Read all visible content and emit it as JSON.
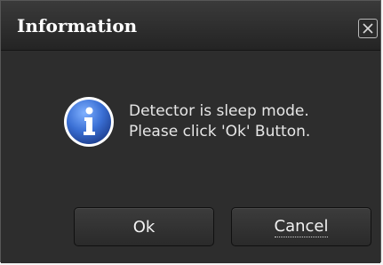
{
  "dialog": {
    "title": "Information",
    "close_icon": "close-icon",
    "icon": "info-icon",
    "message_lines": [
      "Detector is sleep mode.",
      "Please click 'Ok' Button."
    ],
    "buttons": {
      "ok_label": "Ok",
      "cancel_label": "Cancel"
    }
  },
  "colors": {
    "background": "#2b2b2b",
    "text": "#e6e6e6",
    "icon_blue": "#3d6fd0"
  }
}
